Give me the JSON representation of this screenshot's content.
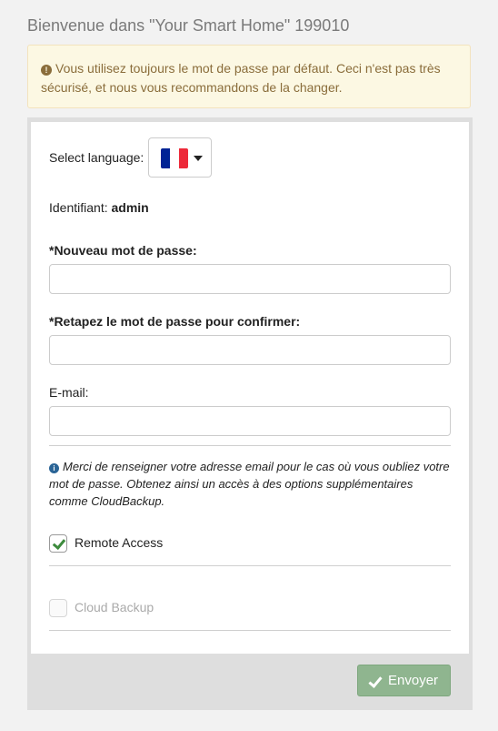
{
  "header": {
    "title": "Bienvenue dans \"Your Smart Home\" 199010"
  },
  "alert": {
    "icon": "exclamation-circle-icon",
    "text": "Vous utilisez toujours le mot de passe par défaut. Ceci n'est pas très sécurisé, et nous vous recommandons de la changer."
  },
  "language": {
    "label": "Select language:",
    "flag": "france-flag",
    "flag_colors": [
      "#002395",
      "#ffffff",
      "#ed2939"
    ]
  },
  "identity": {
    "label": "Identifiant:",
    "value": "admin"
  },
  "fields": {
    "new_password": {
      "label": "*Nouveau mot de passe:",
      "value": "",
      "placeholder": ""
    },
    "confirm_password": {
      "label": "*Retapez le mot de passe pour confirmer:",
      "value": "",
      "placeholder": ""
    },
    "email": {
      "label": "E-mail:",
      "value": "",
      "placeholder": ""
    }
  },
  "info": {
    "icon": "info-circle-icon",
    "text": "Merci de renseigner votre adresse email pour le cas où vous oubliez votre mot de passe. Obtenez ainsi un accès à des options supplémentaires comme CloudBackup."
  },
  "options": {
    "remote_access": {
      "label": "Remote Access",
      "checked": true,
      "disabled": false
    },
    "cloud_backup": {
      "label": "Cloud Backup",
      "checked": false,
      "disabled": true
    }
  },
  "submit": {
    "label": "Envoyer",
    "icon": "check-icon",
    "color": "#8fb58f"
  }
}
